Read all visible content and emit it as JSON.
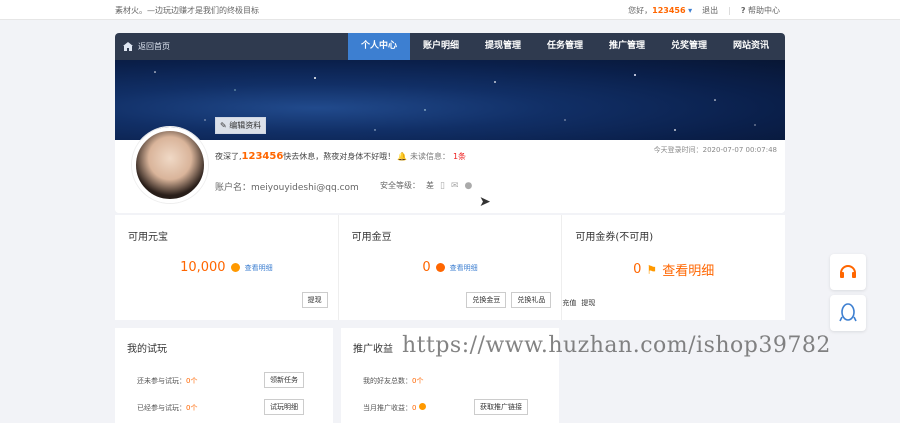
{
  "topbar": {
    "slogan": "素材火。—边玩边赚才是我们的终极目标",
    "greeting_prefix": "您好，",
    "username": "123456",
    "logout": "退出",
    "help": "帮助中心"
  },
  "nav": {
    "home": "返回首页",
    "tabs": [
      "个人中心",
      "账户明细",
      "提现管理",
      "任务管理",
      "推广管理",
      "兑奖管理",
      "网站资讯"
    ]
  },
  "profile": {
    "edit": "编辑资料",
    "greeting_pre": "夜深了,",
    "name": "123456",
    "greeting_post": "快去休息，熬夜对身体不好哦！",
    "unread_label": "未读信息：",
    "unread_count": "1条",
    "last_login": "今天登录时间：2020-07-07 00:07:48",
    "account": "账户名：meiyouyideshi@qq.com",
    "security_label": "安全等级：",
    "security_level": "差"
  },
  "assets": [
    {
      "label": "可用元宝",
      "value": "10,000",
      "link": "查看明细",
      "buttons": [
        "提现"
      ]
    },
    {
      "label": "可用金豆",
      "value": "0",
      "link": "查看明细",
      "buttons": [
        "兑换金豆",
        "兑换礼品"
      ]
    },
    {
      "label": "可用金券(不可用)",
      "value": "0",
      "link": "查看明细",
      "buttons": [
        "充值",
        "提现"
      ]
    }
  ],
  "trial": {
    "title": "我的试玩",
    "row1_label": "还未参与试玩：",
    "row1_val": "0个",
    "row1_btn": "领新任务",
    "row2_label": "已经参与试玩：",
    "row2_val": "0个",
    "row2_btn": "试玩明细"
  },
  "promo": {
    "title": "推广收益",
    "row1_label": "我的好友总数：",
    "row1_val": "0个",
    "row2_label": "当月推广收益：",
    "row2_val": "0",
    "row2_btn": "获取推广链接"
  },
  "watermark": "https://www.huzhan.com/ishop39782",
  "colors": {
    "accent": "#f60",
    "nav_bg": "#2f3a4f",
    "nav_active": "#3d7fd1"
  }
}
